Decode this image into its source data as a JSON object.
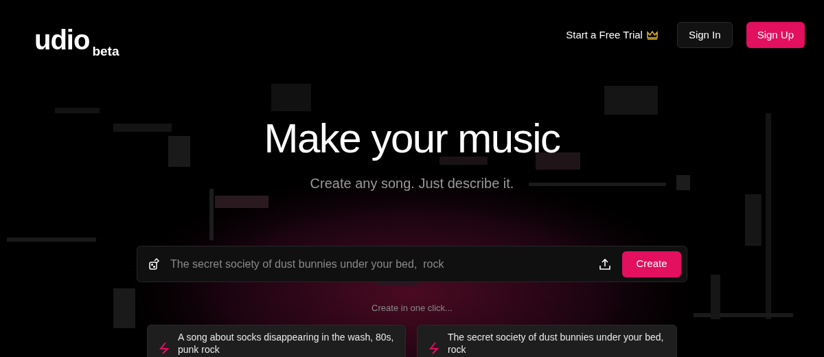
{
  "header": {
    "logo": "udio",
    "logo_badge": "beta",
    "trial_link": "Start a Free Trial",
    "sign_in": "Sign In",
    "sign_up": "Sign Up"
  },
  "hero": {
    "title": "Make your music",
    "subtitle": "Create any song. Just describe it."
  },
  "prompt": {
    "placeholder": "The secret society of dust bunnies under your bed,  rock",
    "button": "Create"
  },
  "quick": {
    "label": "Create in one click...",
    "cards": [
      {
        "text": "A song about socks disappearing in the wash, 80s, punk rock"
      },
      {
        "text": "The secret society of dust bunnies under your bed, rock"
      }
    ]
  }
}
